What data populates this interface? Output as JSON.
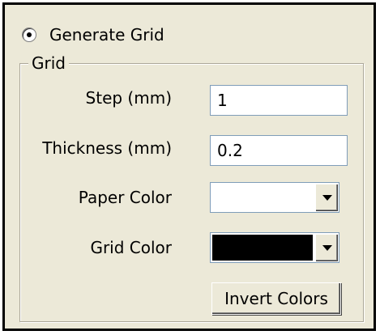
{
  "generate_grid": {
    "label": "Generate Grid",
    "selected": true
  },
  "grid_group": {
    "title": "Grid",
    "step": {
      "label": "Step (mm)",
      "value": "1"
    },
    "thickness": {
      "label": "Thickness (mm)",
      "value": "0.2"
    },
    "paper_color": {
      "label": "Paper Color",
      "color": "#ffffff"
    },
    "grid_color": {
      "label": "Grid Color",
      "color": "#000000"
    },
    "invert_button": "Invert Colors"
  },
  "icons": {
    "dropdown": "chevron-down-icon",
    "radio": "radio-selected-icon"
  }
}
